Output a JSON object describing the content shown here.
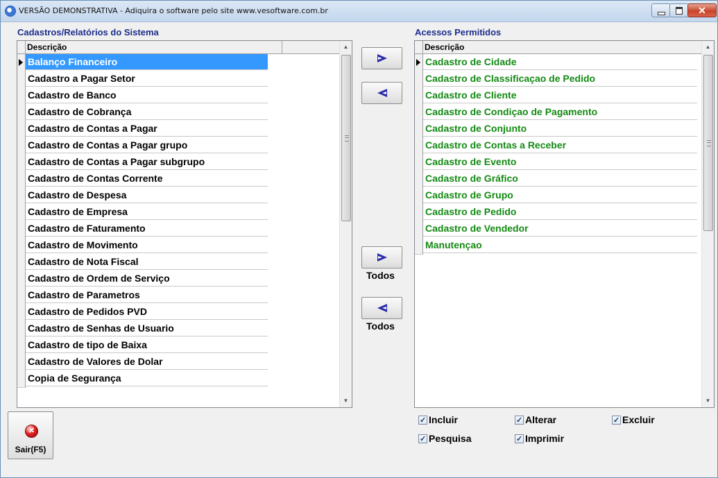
{
  "window": {
    "title": "VERSÃO DEMONSTRATIVA - Adiquira o software pelo site www.vesoftware.com.br",
    "close_glyph": "✕"
  },
  "left_panel": {
    "title": "Cadastros/Relatórios do Sistema",
    "column_header": "Descrição",
    "items": [
      "Balanço Financeiro",
      "Cadastro a Pagar Setor",
      "Cadastro de Banco",
      "Cadastro de Cobrança",
      "Cadastro de Contas a Pagar",
      "Cadastro de Contas a Pagar grupo",
      "Cadastro de Contas a Pagar subgrupo",
      "Cadastro de Contas Corrente",
      "Cadastro de Despesa",
      "Cadastro de Empresa",
      "Cadastro de Faturamento",
      "Cadastro de Movimento",
      "Cadastro de Nota Fiscal",
      "Cadastro de Ordem de Serviço",
      "Cadastro de Parametros",
      "Cadastro de Pedidos PVD",
      "Cadastro de Senhas de Usuario",
      "Cadastro de tipo de Baixa",
      "Cadastro de Valores de Dolar",
      "Copia de Segurança"
    ],
    "selected_index": 0
  },
  "right_panel": {
    "title": "Acessos Permitidos",
    "column_header": "Descrição",
    "items": [
      "Cadastro de Cidade",
      "Cadastro de Classificaçao de Pedido",
      "Cadastro de Cliente",
      "Cadastro de Condiçao de Pagamento",
      "Cadastro de Conjunto",
      "Cadastro de Contas a Receber",
      "Cadastro de Evento",
      "Cadastro de Gráfico",
      "Cadastro de Grupo",
      "Cadastro de Pedido",
      "Cadastro de Vendedor",
      "Manutençao"
    ],
    "text_color": "#138a13"
  },
  "transfer": {
    "todos_label_1": "Todos",
    "todos_label_2": "Todos"
  },
  "permissions": {
    "incluir": "Incluir",
    "alterar": "Alterar",
    "excluir": "Excluir",
    "pesquisa": "Pesquisa",
    "imprimir": "Imprimir"
  },
  "exit_button": {
    "label": "Sair(F5)",
    "icon_glyph": "✕"
  },
  "colors": {
    "selection": "#3399ff",
    "section_title": "#1a2d8c",
    "arrow": "#2a2aa8"
  }
}
